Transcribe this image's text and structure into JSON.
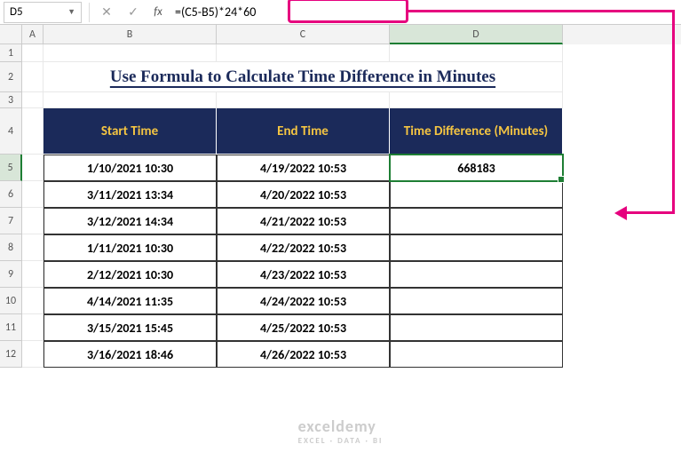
{
  "nameBox": "D5",
  "formula": "=(C5-B5)*24*60",
  "cols": [
    "A",
    "B",
    "C",
    "D"
  ],
  "title": "Use Formula to Calculate Time Difference in Minutes",
  "headers": {
    "b": "Start Time",
    "c": "End Time",
    "d": "Time Difference (Minutes)"
  },
  "rows": [
    {
      "b": "1/10/2021 10:30",
      "c": "4/19/2022 10:53",
      "d": "668183"
    },
    {
      "b": "3/11/2021 13:34",
      "c": "4/20/2022 10:53",
      "d": ""
    },
    {
      "b": "3/12/2021 14:34",
      "c": "4/21/2022 10:53",
      "d": ""
    },
    {
      "b": "1/11/2021 10:30",
      "c": "4/22/2022 10:53",
      "d": ""
    },
    {
      "b": "2/12/2021 10:30",
      "c": "4/23/2022 10:53",
      "d": ""
    },
    {
      "b": "4/14/2021 11:35",
      "c": "4/24/2022 10:53",
      "d": ""
    },
    {
      "b": "3/15/2021 15:45",
      "c": "4/25/2022 10:53",
      "d": ""
    },
    {
      "b": "3/16/2021 18:46",
      "c": "4/26/2022 10:53",
      "d": ""
    }
  ],
  "watermark": {
    "main": "exceldemy",
    "sub": "EXCEL · DATA · BI"
  }
}
